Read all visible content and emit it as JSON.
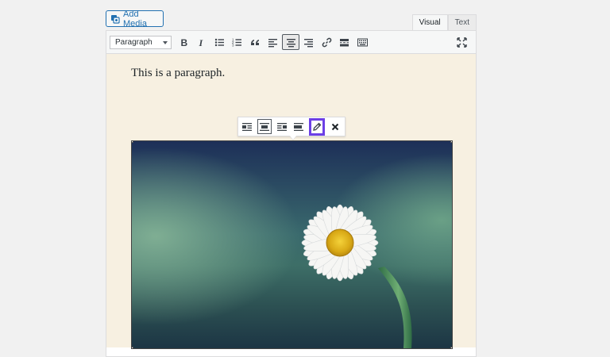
{
  "header": {
    "add_media_label": "Add Media"
  },
  "mode_tabs": [
    {
      "label": "Visual",
      "active": true
    },
    {
      "label": "Text",
      "active": false
    }
  ],
  "toolbar": {
    "format_value": "Paragraph",
    "buttons": [
      "bold-icon",
      "italic-icon",
      "bulleted-list-icon",
      "numbered-list-icon",
      "blockquote-icon",
      "align-left-icon",
      "align-center-icon",
      "align-right-icon",
      "link-icon",
      "read-more-icon",
      "toolbar-toggle-icon"
    ],
    "active_button": "align-center-icon",
    "expand_icon": "fullscreen-icon"
  },
  "content": {
    "paragraph": "This is a paragraph."
  },
  "image_toolbar": {
    "buttons": [
      "image-align-left-icon",
      "image-align-center-icon",
      "image-align-right-icon",
      "image-align-none-icon",
      "pencil-edit-icon",
      "remove-icon"
    ],
    "pressed": "image-align-center-icon",
    "highlighted": "pencil-edit-icon",
    "highlight_color": "#6c3fe6"
  },
  "image": {
    "subject": "daisy-flower"
  }
}
